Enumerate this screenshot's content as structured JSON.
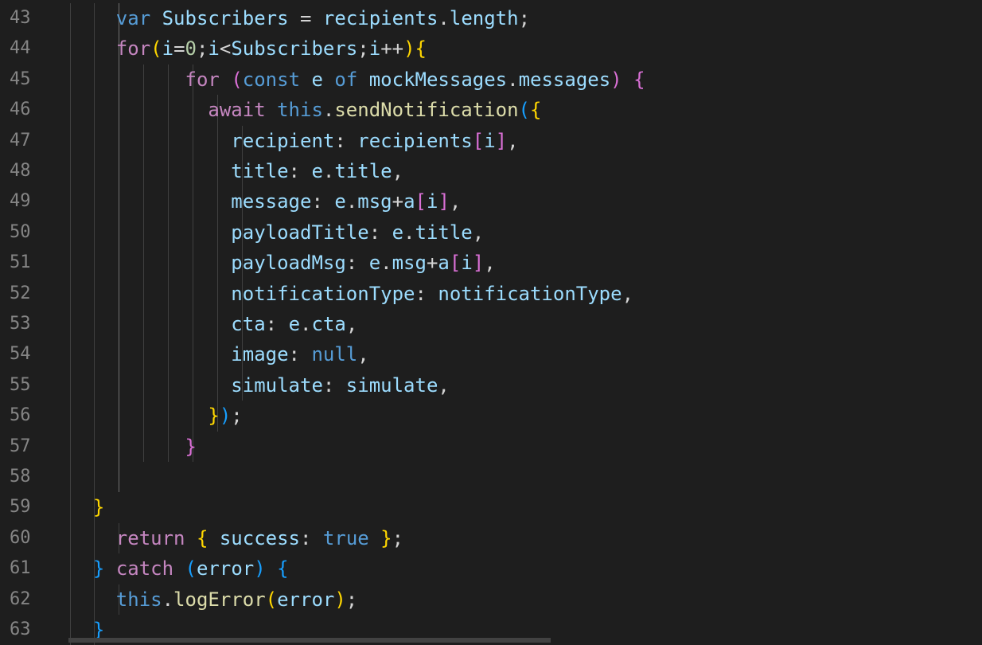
{
  "editor": {
    "lines": [
      {
        "n": "43",
        "indent": 4,
        "tokens": [
          [
            "var",
            "kw"
          ],
          [
            " ",
            "p"
          ],
          [
            "Subscribers",
            "var"
          ],
          [
            " = ",
            "p"
          ],
          [
            "recipients",
            "var"
          ],
          [
            ".",
            "p"
          ],
          [
            "length",
            "prop"
          ],
          [
            ";",
            "p"
          ]
        ]
      },
      {
        "n": "44",
        "indent": 4,
        "tokens": [
          [
            "for",
            "ctl"
          ],
          [
            "(",
            "b1"
          ],
          [
            "i",
            "var"
          ],
          [
            "=",
            "p"
          ],
          [
            "0",
            "num"
          ],
          [
            ";",
            "p"
          ],
          [
            "i",
            "var"
          ],
          [
            "<",
            "p"
          ],
          [
            "Subscribers",
            "var"
          ],
          [
            ";",
            "p"
          ],
          [
            "i",
            "var"
          ],
          [
            "++",
            "p"
          ],
          [
            ")",
            "b1"
          ],
          [
            "{",
            "b1"
          ]
        ]
      },
      {
        "n": "45",
        "indent": 10,
        "tokens": [
          [
            "for",
            "ctl"
          ],
          [
            " ",
            "p"
          ],
          [
            "(",
            "b2"
          ],
          [
            "const",
            "kw"
          ],
          [
            " ",
            "p"
          ],
          [
            "e",
            "var"
          ],
          [
            " ",
            "p"
          ],
          [
            "of",
            "kw"
          ],
          [
            " ",
            "p"
          ],
          [
            "mockMessages",
            "var"
          ],
          [
            ".",
            "p"
          ],
          [
            "messages",
            "prop"
          ],
          [
            ")",
            "b2"
          ],
          [
            " ",
            "p"
          ],
          [
            "{",
            "b2"
          ]
        ]
      },
      {
        "n": "46",
        "indent": 12,
        "tokens": [
          [
            "await",
            "ctl"
          ],
          [
            " ",
            "p"
          ],
          [
            "this",
            "kw"
          ],
          [
            ".",
            "p"
          ],
          [
            "sendNotification",
            "fn"
          ],
          [
            "(",
            "b3"
          ],
          [
            "{",
            "b1"
          ]
        ]
      },
      {
        "n": "47",
        "indent": 14,
        "tokens": [
          [
            "recipient",
            "prop"
          ],
          [
            ": ",
            "p"
          ],
          [
            "recipients",
            "var"
          ],
          [
            "[",
            "b2"
          ],
          [
            "i",
            "var"
          ],
          [
            "]",
            "b2"
          ],
          [
            ",",
            "p"
          ]
        ]
      },
      {
        "n": "48",
        "indent": 14,
        "tokens": [
          [
            "title",
            "prop"
          ],
          [
            ": ",
            "p"
          ],
          [
            "e",
            "var"
          ],
          [
            ".",
            "p"
          ],
          [
            "title",
            "prop"
          ],
          [
            ",",
            "p"
          ]
        ]
      },
      {
        "n": "49",
        "indent": 14,
        "tokens": [
          [
            "message",
            "prop"
          ],
          [
            ": ",
            "p"
          ],
          [
            "e",
            "var"
          ],
          [
            ".",
            "p"
          ],
          [
            "msg",
            "prop"
          ],
          [
            "+",
            "p"
          ],
          [
            "a",
            "var"
          ],
          [
            "[",
            "b2"
          ],
          [
            "i",
            "var"
          ],
          [
            "]",
            "b2"
          ],
          [
            ",",
            "p"
          ]
        ]
      },
      {
        "n": "50",
        "indent": 14,
        "tokens": [
          [
            "payloadTitle",
            "prop"
          ],
          [
            ": ",
            "p"
          ],
          [
            "e",
            "var"
          ],
          [
            ".",
            "p"
          ],
          [
            "title",
            "prop"
          ],
          [
            ",",
            "p"
          ]
        ]
      },
      {
        "n": "51",
        "indent": 14,
        "tokens": [
          [
            "payloadMsg",
            "prop"
          ],
          [
            ": ",
            "p"
          ],
          [
            "e",
            "var"
          ],
          [
            ".",
            "p"
          ],
          [
            "msg",
            "prop"
          ],
          [
            "+",
            "p"
          ],
          [
            "a",
            "var"
          ],
          [
            "[",
            "b2"
          ],
          [
            "i",
            "var"
          ],
          [
            "]",
            "b2"
          ],
          [
            ",",
            "p"
          ]
        ]
      },
      {
        "n": "52",
        "indent": 14,
        "tokens": [
          [
            "notificationType",
            "prop"
          ],
          [
            ": ",
            "p"
          ],
          [
            "notificationType",
            "var"
          ],
          [
            ",",
            "p"
          ]
        ]
      },
      {
        "n": "53",
        "indent": 14,
        "tokens": [
          [
            "cta",
            "prop"
          ],
          [
            ": ",
            "p"
          ],
          [
            "e",
            "var"
          ],
          [
            ".",
            "p"
          ],
          [
            "cta",
            "prop"
          ],
          [
            ",",
            "p"
          ]
        ]
      },
      {
        "n": "54",
        "indent": 14,
        "tokens": [
          [
            "image",
            "prop"
          ],
          [
            ": ",
            "p"
          ],
          [
            "null",
            "kw"
          ],
          [
            ",",
            "p"
          ]
        ]
      },
      {
        "n": "55",
        "indent": 14,
        "tokens": [
          [
            "simulate",
            "prop"
          ],
          [
            ": ",
            "p"
          ],
          [
            "simulate",
            "var"
          ],
          [
            ",",
            "p"
          ]
        ]
      },
      {
        "n": "56",
        "indent": 12,
        "tokens": [
          [
            "}",
            "b1"
          ],
          [
            ")",
            "b3"
          ],
          [
            ";",
            "p"
          ]
        ]
      },
      {
        "n": "57",
        "indent": 10,
        "tokens": [
          [
            "}",
            "b2"
          ]
        ]
      },
      {
        "n": "58",
        "indent": 0,
        "tokens": []
      },
      {
        "n": "59",
        "indent": 2,
        "tokens": [
          [
            "}",
            "b1"
          ]
        ]
      },
      {
        "n": "60",
        "indent": 4,
        "tokens": [
          [
            "return",
            "ctl"
          ],
          [
            " ",
            "p"
          ],
          [
            "{",
            "b1"
          ],
          [
            " ",
            "p"
          ],
          [
            "success",
            "prop"
          ],
          [
            ": ",
            "p"
          ],
          [
            "true",
            "kw"
          ],
          [
            " ",
            "p"
          ],
          [
            "}",
            "b1"
          ],
          [
            ";",
            "p"
          ]
        ]
      },
      {
        "n": "61",
        "indent": 2,
        "tokens": [
          [
            "}",
            "b3"
          ],
          [
            " ",
            "p"
          ],
          [
            "catch",
            "ctl"
          ],
          [
            " ",
            "p"
          ],
          [
            "(",
            "b3"
          ],
          [
            "error",
            "var"
          ],
          [
            ")",
            "b3"
          ],
          [
            " ",
            "p"
          ],
          [
            "{",
            "b3"
          ]
        ]
      },
      {
        "n": "62",
        "indent": 4,
        "tokens": [
          [
            "this",
            "kw"
          ],
          [
            ".",
            "p"
          ],
          [
            "logError",
            "fn"
          ],
          [
            "(",
            "b1"
          ],
          [
            "error",
            "var"
          ],
          [
            ")",
            "b1"
          ],
          [
            ";",
            "p"
          ]
        ]
      },
      {
        "n": "63",
        "indent": 2,
        "tokens": [
          [
            "}",
            "b3"
          ]
        ]
      }
    ]
  },
  "colors": {
    "background": "#1e1e1e",
    "line_number": "#858585",
    "keyword": "#569cd6",
    "control": "#c586c0",
    "variable": "#9cdcfe",
    "function": "#dcdcaa",
    "number": "#b5cea8",
    "bracket_gold": "#ffd700",
    "bracket_orchid": "#da70d6",
    "bracket_blue": "#179fff"
  }
}
